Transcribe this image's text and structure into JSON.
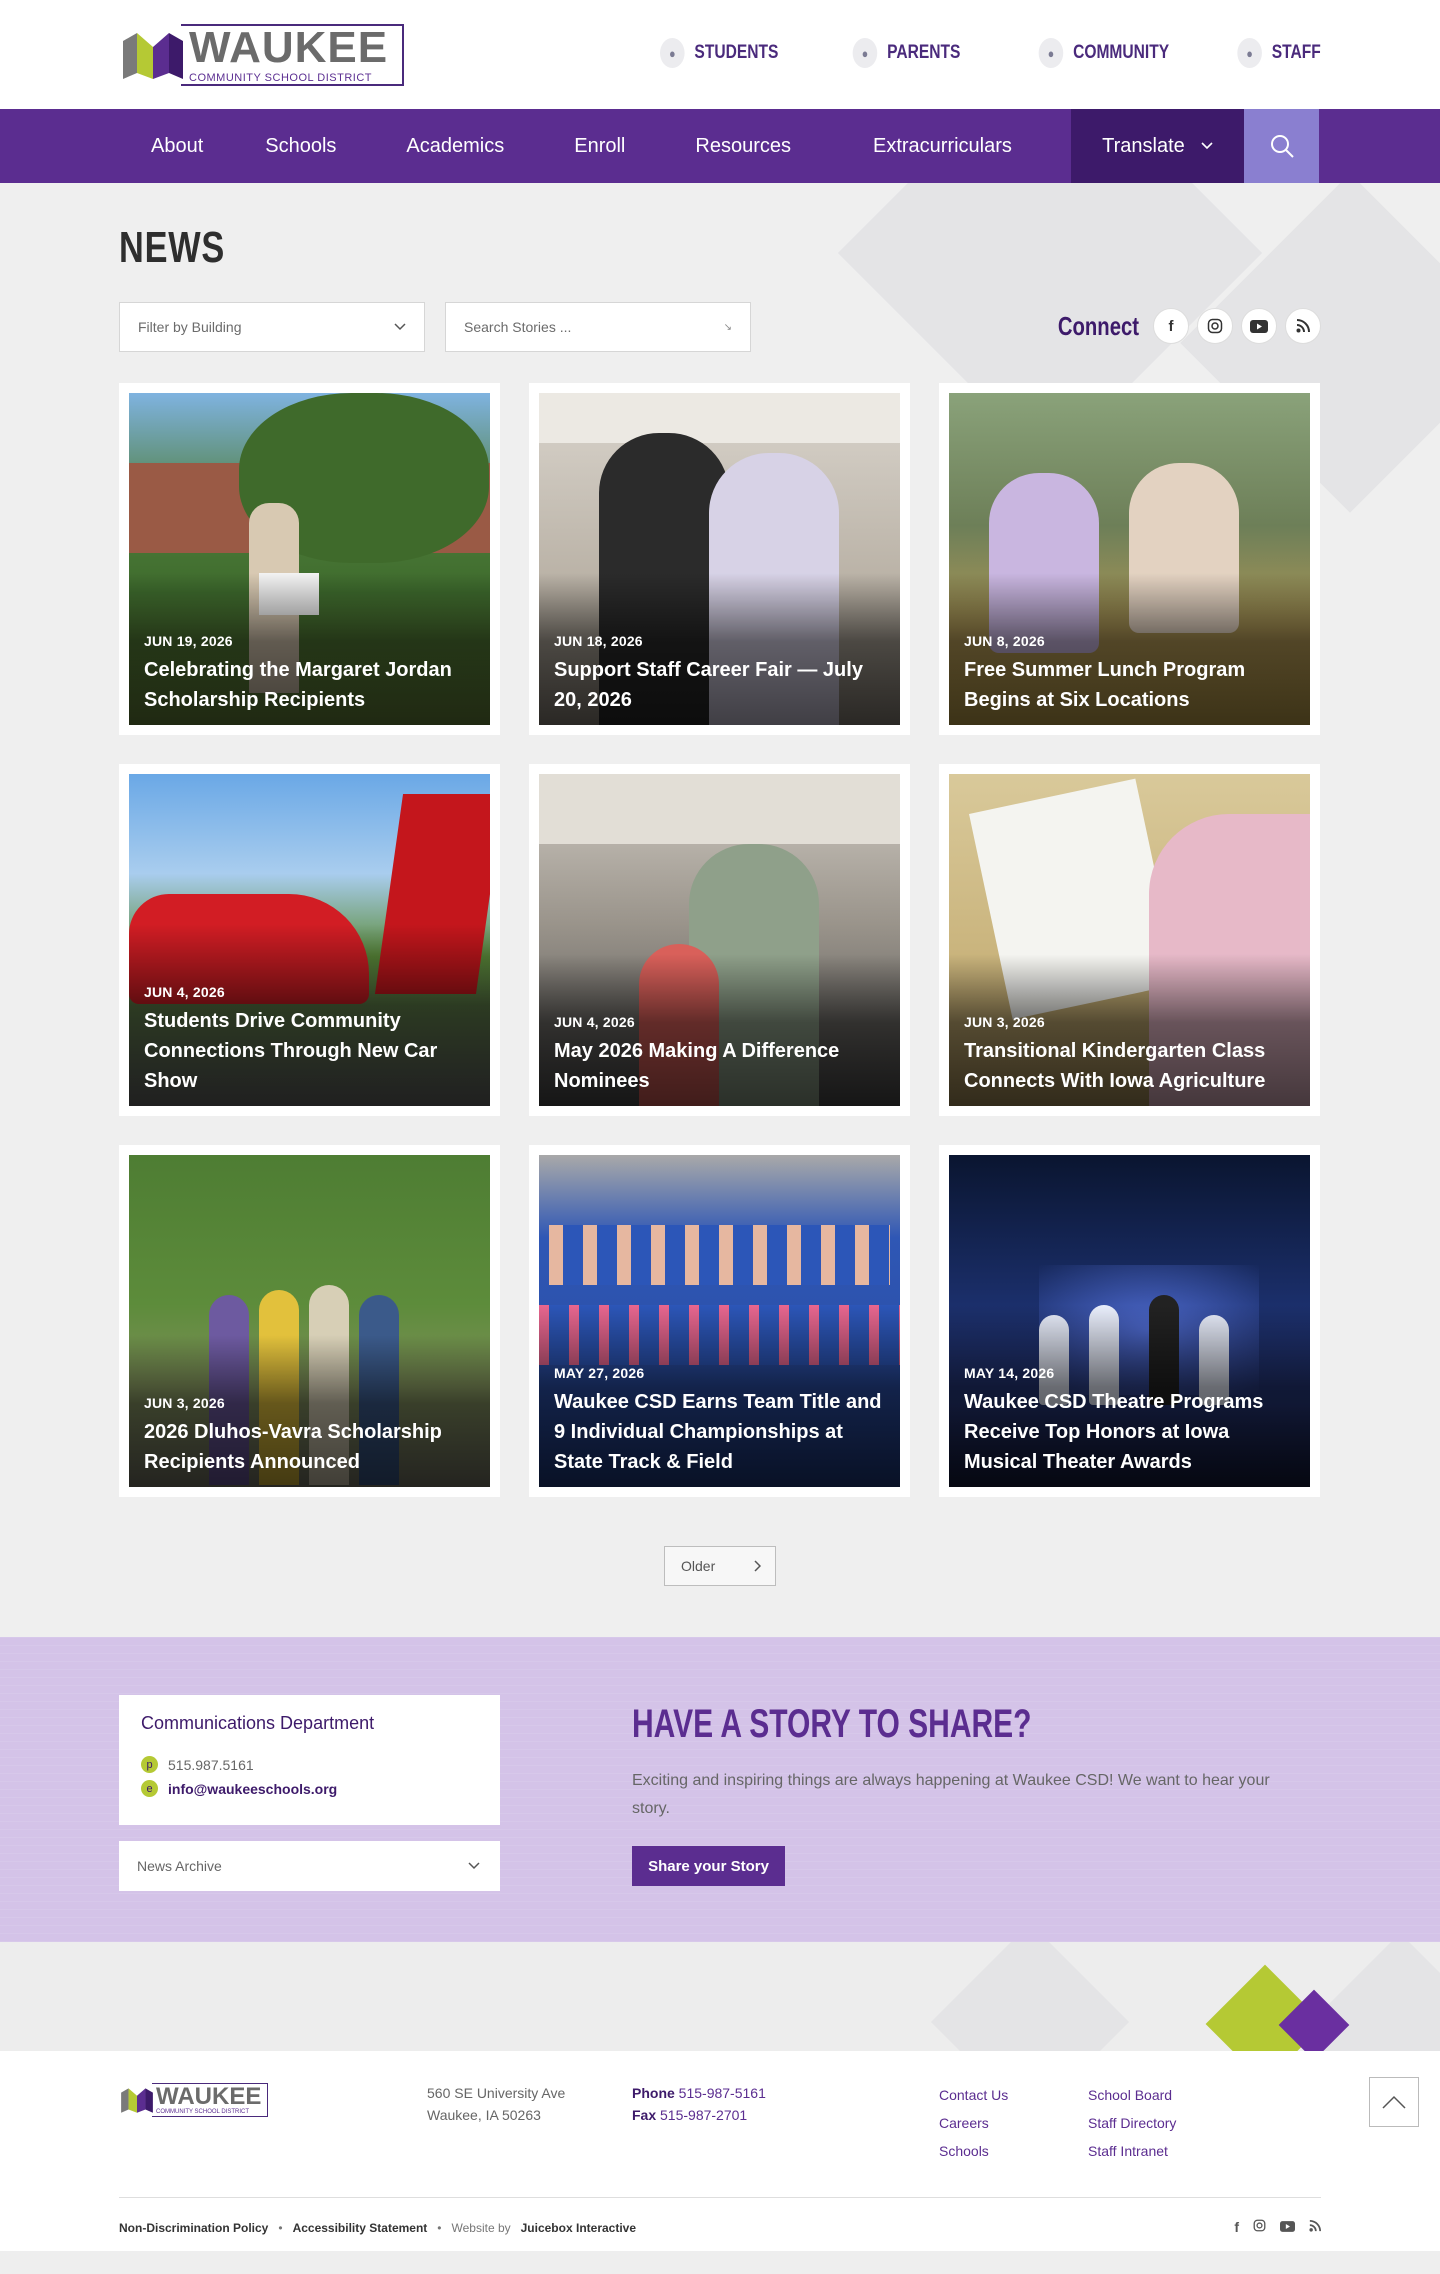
{
  "brand": {
    "name": "WAUKEE",
    "subtitle": "COMMUNITY SCHOOL DISTRICT",
    "colors": {
      "purple": "#5b2d90",
      "dark_purple": "#3d1a6a",
      "lime": "#b5c934",
      "lavender": "#d4c3e8"
    }
  },
  "audience_nav": [
    {
      "label": "STUDENTS",
      "icon": "student-icon"
    },
    {
      "label": "PARENTS",
      "icon": "parents-icon"
    },
    {
      "label": "COMMUNITY",
      "icon": "community-icon"
    },
    {
      "label": "STAFF",
      "icon": "staff-icon"
    }
  ],
  "main_nav": [
    "About",
    "Schools",
    "Academics",
    "Enroll",
    "Resources",
    "Extracurriculars"
  ],
  "translate_label": "Translate",
  "page_title": "NEWS",
  "filters": {
    "building": "Filter by Building",
    "search": "Search Stories ..."
  },
  "connect_label": "Connect",
  "social": [
    "facebook-icon",
    "instagram-icon",
    "youtube-icon",
    "rss-icon"
  ],
  "stories": [
    {
      "date": "JUN 19, 2026",
      "title": "Celebrating the Margaret Jordan Scholarship Recipients"
    },
    {
      "date": "JUN 18, 2026",
      "title": "Support Staff Career Fair — July 20, 2026"
    },
    {
      "date": "JUN 8, 2026",
      "title": "Free Summer Lunch Program Begins at Six Locations"
    },
    {
      "date": "JUN 4, 2026",
      "title": "Students Drive Community Connections Through New Car Show"
    },
    {
      "date": "JUN 4, 2026",
      "title": "May 2026 Making A Difference Nominees"
    },
    {
      "date": "JUN 3, 2026",
      "title": "Transitional Kindergarten Class Connects With Iowa Agriculture"
    },
    {
      "date": "JUN 3, 2026",
      "title": "2026 Dluhos-Vavra Scholarship Recipients Announced"
    },
    {
      "date": "MAY 27, 2026",
      "title": "Waukee CSD Earns Team Title and 9 Individual Championships at State Track & Field"
    },
    {
      "date": "MAY 14, 2026",
      "title": "Waukee CSD Theatre Programs Receive Top Honors at Iowa Musical Theater Awards"
    }
  ],
  "pagination": {
    "older_label": "Older"
  },
  "contact": {
    "title": "Communications Department",
    "phone_badge": "p",
    "phone": "515.987.5161",
    "email_badge": "e",
    "email": "info@waukeeschools.org"
  },
  "archive_label": "News Archive",
  "share": {
    "heading": "HAVE A STORY TO SHARE?",
    "text": "Exciting and inspiring things are always happening at Waukee CSD! We want to hear your story.",
    "button": "Share your Story"
  },
  "footer": {
    "address_line1": "560 SE University Ave",
    "address_line2": "Waukee, IA 50263",
    "phone_label": "Phone",
    "phone": "515-987-5161",
    "fax_label": "Fax",
    "fax": "515-987-2701",
    "links_col1": [
      "Contact Us",
      "Careers",
      "Schools"
    ],
    "links_col2": [
      "School Board",
      "Staff Directory",
      "Staff Intranet"
    ],
    "legal": {
      "nondiscrimination": "Non-Discrimination Policy",
      "accessibility": "Accessibility Statement",
      "credit_prefix": "Website by",
      "credit_name": "Juicebox Interactive"
    }
  }
}
